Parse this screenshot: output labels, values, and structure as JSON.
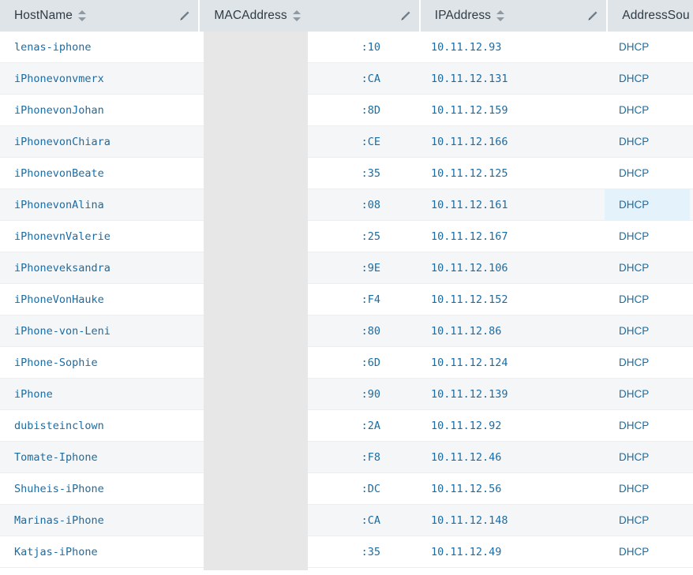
{
  "table": {
    "columns": [
      {
        "label": "HostName",
        "sort_icon": "sort-updown-icon",
        "edit_icon": "pencil-icon",
        "sortable": true,
        "editable": true
      },
      {
        "label": "MACAddress",
        "sort_icon": "sort-updown-icon",
        "edit_icon": "pencil-icon",
        "sortable": true,
        "editable": true
      },
      {
        "label": "IPAddress",
        "sort_icon": "sort-updown-icon",
        "edit_icon": "pencil-icon",
        "sortable": true,
        "editable": true
      },
      {
        "label": "AddressSou",
        "sort_icon": "",
        "edit_icon": "",
        "sortable": false,
        "editable": false
      }
    ],
    "rows": [
      {
        "hostname": "lenas-iphone",
        "mac": ":10",
        "ip": "10.11.12.93",
        "source": "DHCP",
        "source_highlighted": false
      },
      {
        "hostname": "iPhonevonvmerx",
        "mac": ":CA",
        "ip": "10.11.12.131",
        "source": "DHCP",
        "source_highlighted": false
      },
      {
        "hostname": "iPhonevonJohan",
        "mac": ":8D",
        "ip": "10.11.12.159",
        "source": "DHCP",
        "source_highlighted": false
      },
      {
        "hostname": "iPhonevonChiara",
        "mac": ":CE",
        "ip": "10.11.12.166",
        "source": "DHCP",
        "source_highlighted": false
      },
      {
        "hostname": "iPhonevonBeate",
        "mac": ":35",
        "ip": "10.11.12.125",
        "source": "DHCP",
        "source_highlighted": false
      },
      {
        "hostname": "iPhonevonAlina",
        "mac": ":08",
        "ip": "10.11.12.161",
        "source": "DHCP",
        "source_highlighted": true
      },
      {
        "hostname": "iPhonevnValerie",
        "mac": ":25",
        "ip": "10.11.12.167",
        "source": "DHCP",
        "source_highlighted": false
      },
      {
        "hostname": "iPhoneveksandra",
        "mac": ":9E",
        "ip": "10.11.12.106",
        "source": "DHCP",
        "source_highlighted": false
      },
      {
        "hostname": "iPhoneVonHauke",
        "mac": ":F4",
        "ip": "10.11.12.152",
        "source": "DHCP",
        "source_highlighted": false
      },
      {
        "hostname": "iPhone-von-Leni",
        "mac": ":80",
        "ip": "10.11.12.86",
        "source": "DHCP",
        "source_highlighted": false
      },
      {
        "hostname": "iPhone-Sophie",
        "mac": ":6D",
        "ip": "10.11.12.124",
        "source": "DHCP",
        "source_highlighted": false
      },
      {
        "hostname": "iPhone",
        "mac": ":90",
        "ip": "10.11.12.139",
        "source": "DHCP",
        "source_highlighted": false
      },
      {
        "hostname": "dubisteinclown",
        "mac": ":2A",
        "ip": "10.11.12.92",
        "source": "DHCP",
        "source_highlighted": false
      },
      {
        "hostname": "Tomate-Iphone",
        "mac": ":F8",
        "ip": "10.11.12.46",
        "source": "DHCP",
        "source_highlighted": false
      },
      {
        "hostname": "Shuheis-iPhone",
        "mac": ":DC",
        "ip": "10.11.12.56",
        "source": "DHCP",
        "source_highlighted": false
      },
      {
        "hostname": "Marinas-iPhone",
        "mac": ":CA",
        "ip": "10.11.12.148",
        "source": "DHCP",
        "source_highlighted": false
      },
      {
        "hostname": "Katjas-iPhone",
        "mac": ":35",
        "ip": "10.11.12.49",
        "source": "DHCP",
        "source_highlighted": false
      }
    ]
  },
  "colors": {
    "header_bg": "#dfe4e8",
    "header_text": "#2f3c45",
    "link_text": "#1a6ca4",
    "row_alt_bg": "#f4f6f7",
    "cell_highlight_bg": "#e4f2fb",
    "redaction_bg": "#e7e7e7"
  }
}
